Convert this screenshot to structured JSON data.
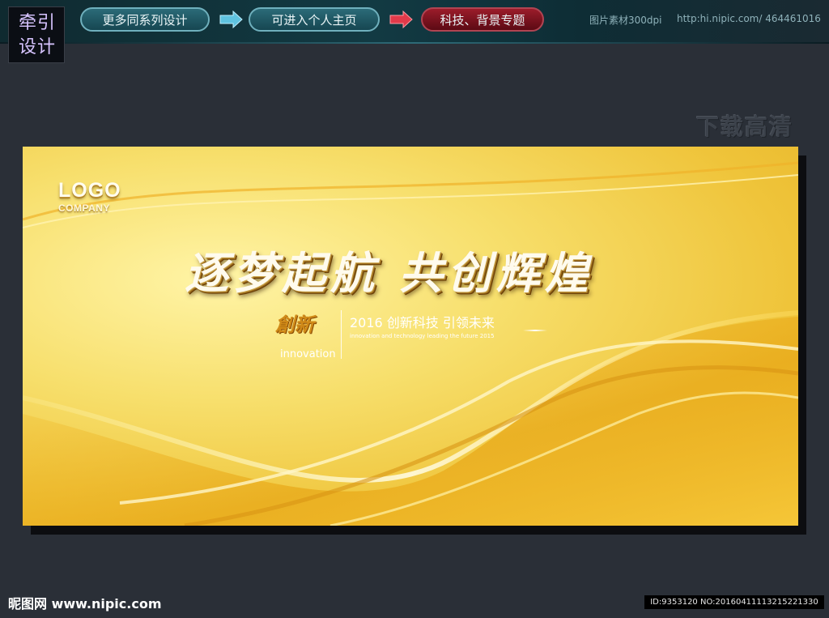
{
  "brand": {
    "line1": "牵引",
    "line2": "设计"
  },
  "nav": {
    "more_series": "更多同系列设计",
    "personal_home": "可进入个人主页",
    "tech_topic": "科技、背景专题"
  },
  "top_info": {
    "resolution": "图片素材300dpi",
    "url": "http:hi.nipic.com/ 464461016"
  },
  "download_hd": "下载高清",
  "poster": {
    "logo": "LOGO",
    "company": "COMPANY",
    "headline": "逐梦起航 共创辉煌",
    "badge_cn": "創新",
    "badge_en": "innovation",
    "tagline_cn": "2016 创新科技 引领未来",
    "tagline_en": "innovation and technology leading the future 2015"
  },
  "footer": {
    "site": "昵图网 www.nipic.com",
    "id_text": "ID:9353120 NO:20160411113215221330"
  },
  "colors": {
    "page_bg": "#2a2f37",
    "pill_teal": "#164651",
    "pill_red": "#5c0a14",
    "gold": "#efc43a"
  },
  "icons": [
    "arrow-right-icon",
    "arrow-right-red-icon"
  ]
}
